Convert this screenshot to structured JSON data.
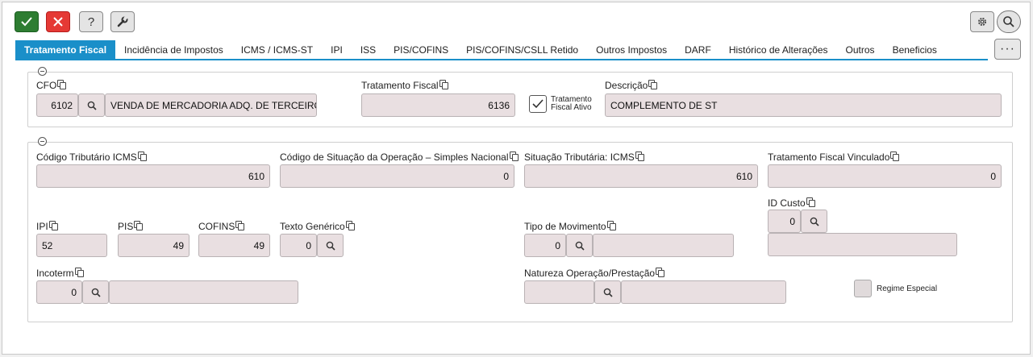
{
  "toolbar": {
    "confirm_icon": "check-icon",
    "cancel_icon": "close-icon",
    "help_label": "?",
    "tools_icon": "wrench-icon",
    "settings_icon": "gear-icon",
    "search_icon": "search-icon",
    "more_label": "···"
  },
  "tabs": [
    {
      "label": "Tratamento Fiscal",
      "active": true
    },
    {
      "label": "Incidência de Impostos"
    },
    {
      "label": "ICMS / ICMS-ST"
    },
    {
      "label": "IPI"
    },
    {
      "label": "ISS"
    },
    {
      "label": "PIS/COFINS"
    },
    {
      "label": "PIS/COFINS/CSLL Retido"
    },
    {
      "label": "Outros Impostos"
    },
    {
      "label": "DARF"
    },
    {
      "label": "Histórico de Alterações"
    },
    {
      "label": "Outros"
    },
    {
      "label": "Beneficios"
    }
  ],
  "section1": {
    "cfo": {
      "label": "CFO",
      "code": "6102",
      "description": "VENDA DE MERCADORIA ADQ. DE TERCEIROS"
    },
    "tratamento_fiscal": {
      "label": "Tratamento Fiscal",
      "value": "6136"
    },
    "ativo": {
      "line1": "Tratamento",
      "line2": "Fiscal Ativo",
      "checked": true
    },
    "descricao": {
      "label": "Descrição",
      "value": "COMPLEMENTO DE ST"
    }
  },
  "section2": {
    "codigo_tributario": {
      "label": "Código Tributário ICMS",
      "value": "610"
    },
    "situacao_operacao": {
      "label": "Código de Situação da Operação – Simples Nacional",
      "value": "0"
    },
    "situacao_tributaria": {
      "label": "Situação Tributária: ICMS",
      "value": "610"
    },
    "tratamento_vinculado": {
      "label": "Tratamento Fiscal Vinculado",
      "value": "0"
    },
    "id_custo": {
      "label": "ID Custo",
      "value": "0",
      "description": ""
    },
    "ipi": {
      "label": "IPI",
      "value": "52"
    },
    "pis": {
      "label": "PIS",
      "value": "49"
    },
    "cofins": {
      "label": "COFINS",
      "value": "49"
    },
    "texto_generico": {
      "label": "Texto Genérico",
      "value": "0"
    },
    "tipo_movimento": {
      "label": "Tipo de Movimento",
      "value": "0",
      "description": ""
    },
    "incoterm": {
      "label": "Incoterm",
      "value": "0",
      "description": ""
    },
    "natureza": {
      "label": "Natureza Operação/Prestação",
      "value": "",
      "description": ""
    },
    "regime_especial": {
      "label": "Regime Especial",
      "checked": false
    }
  }
}
